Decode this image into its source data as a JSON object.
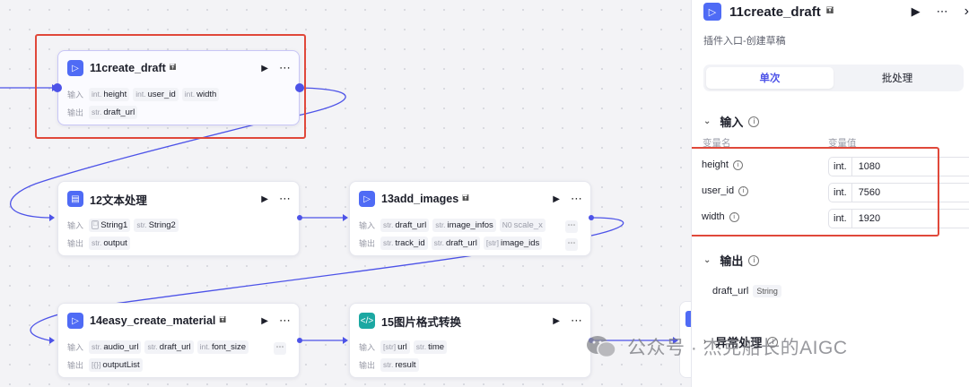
{
  "canvas": {
    "nodes": {
      "n11": {
        "title": "11create_draft",
        "icon": "play-plugin-icon",
        "in_label": "输入",
        "out_label": "输出",
        "inputs": [
          {
            "type": "int.",
            "name": "height"
          },
          {
            "type": "int.",
            "name": "user_id"
          },
          {
            "type": "int.",
            "name": "width"
          }
        ],
        "outputs": [
          {
            "type": "str.",
            "name": "draft_url"
          }
        ]
      },
      "n12": {
        "title": "12文本处理",
        "icon": "text-process-icon",
        "in_label": "输入",
        "out_label": "输出",
        "inputs": [
          {
            "type": "image-icon",
            "name": "String1"
          },
          {
            "type": "str.",
            "name": "String2"
          }
        ],
        "outputs": [
          {
            "type": "str.",
            "name": "output"
          }
        ]
      },
      "n13": {
        "title": "13add_images",
        "icon": "play-plugin-icon",
        "in_label": "输入",
        "out_label": "输出",
        "inputs": [
          {
            "type": "str.",
            "name": "draft_url"
          },
          {
            "type": "str.",
            "name": "image_infos"
          },
          {
            "type": "N0",
            "name": "scale_x"
          }
        ],
        "outputs": [
          {
            "type": "str.",
            "name": "track_id"
          },
          {
            "type": "str.",
            "name": "draft_url"
          },
          {
            "type": "[str]",
            "name": "image_ids"
          }
        ]
      },
      "n14": {
        "title": "14easy_create_material",
        "icon": "play-plugin-icon",
        "in_label": "输入",
        "out_label": "输出",
        "inputs": [
          {
            "type": "str.",
            "name": "audio_url"
          },
          {
            "type": "str.",
            "name": "draft_url"
          },
          {
            "type": "int.",
            "name": "font_size"
          }
        ],
        "outputs": [
          {
            "type": "[{}]",
            "name": "outputList"
          }
        ]
      },
      "n15": {
        "title": "15图片格式转换",
        "icon": "code-icon",
        "in_label": "输入",
        "out_label": "输出",
        "inputs": [
          {
            "type": "[str]",
            "name": "url"
          },
          {
            "type": "str.",
            "name": "time"
          }
        ],
        "outputs": [
          {
            "type": "str.",
            "name": "result"
          }
        ]
      }
    }
  },
  "panel": {
    "title": "11create_draft",
    "description": "插件入口-创建草稿",
    "tabs": [
      "单次",
      "批处理"
    ],
    "active_tab": "单次",
    "input_section": "输入",
    "col_name": "变量名",
    "col_value": "变量值",
    "params": [
      {
        "name": "height",
        "type": "int.",
        "value": "1080"
      },
      {
        "name": "user_id",
        "type": "int.",
        "value": "7560"
      },
      {
        "name": "width",
        "type": "int.",
        "value": "1920"
      }
    ],
    "output_section": "输出",
    "output_var": "draft_url",
    "output_type": "String",
    "error_section": "异常处理"
  },
  "watermark": "公众号 · 杰克船长的AIGC",
  "colors": {
    "accent": "#4d53e8",
    "highlight": "#e0483a",
    "plugin_icon": "#4f6bf5",
    "code_icon": "#1ba8a2"
  }
}
